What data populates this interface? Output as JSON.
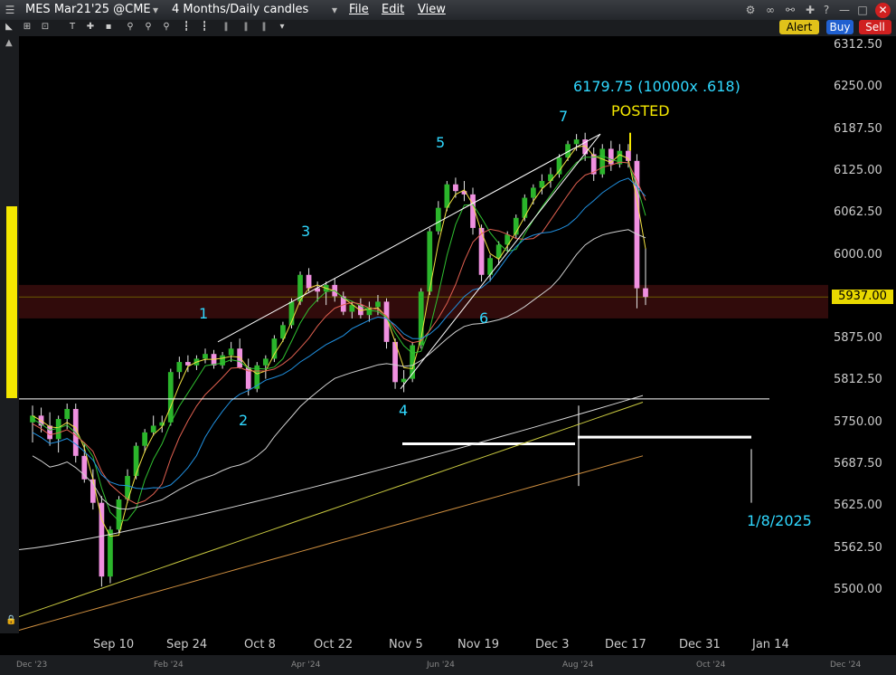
{
  "window": {
    "symbol": "MES Mar21'25 @CME",
    "timeframe": "4 Months/Daily candles",
    "menu": [
      "File",
      "Edit",
      "View"
    ],
    "buttons": {
      "alert": "Alert",
      "buy": "Buy",
      "sell": "Sell"
    }
  },
  "chart_data": {
    "type": "candlestick",
    "y_ticks": [
      "6312.50",
      "6250.00",
      "6187.50",
      "6125.00",
      "6062.50",
      "6000.00",
      "5937.50",
      "5875.00",
      "5812.50",
      "5750.00",
      "5687.50",
      "5625.00",
      "5562.50",
      "5500.00"
    ],
    "ylim": [
      5455,
      6330
    ],
    "x_ticks": [
      "Sep 10",
      "Sep 24",
      "Oct 8",
      "Oct 22",
      "Nov 5",
      "Nov 19",
      "Dec 3",
      "Dec 17",
      "Dec 31",
      "Jan 14"
    ],
    "last_price": "5937.00",
    "scroll_labels": [
      "Dec '23",
      "Feb '24",
      "Apr '24",
      "Jun '24",
      "Aug '24",
      "Oct '24",
      "Dec '24"
    ],
    "annotations": {
      "target": "6179.75 (10000x .618)",
      "posted": "POSTED",
      "date": "1/8/2025",
      "waves": [
        "1",
        "2",
        "3",
        "4",
        "5",
        "6",
        "7"
      ]
    },
    "candles": [
      [
        5750,
        5775,
        5720,
        5760
      ],
      [
        5760,
        5772,
        5735,
        5745
      ],
      [
        5745,
        5765,
        5715,
        5725
      ],
      [
        5725,
        5760,
        5705,
        5755
      ],
      [
        5755,
        5778,
        5740,
        5770
      ],
      [
        5770,
        5778,
        5690,
        5700
      ],
      [
        5700,
        5720,
        5660,
        5665
      ],
      [
        5665,
        5680,
        5620,
        5630
      ],
      [
        5630,
        5640,
        5505,
        5520
      ],
      [
        5520,
        5595,
        5510,
        5590
      ],
      [
        5590,
        5640,
        5585,
        5635
      ],
      [
        5635,
        5680,
        5630,
        5670
      ],
      [
        5670,
        5720,
        5665,
        5715
      ],
      [
        5715,
        5740,
        5705,
        5735
      ],
      [
        5735,
        5760,
        5730,
        5745
      ],
      [
        5745,
        5760,
        5735,
        5750
      ],
      [
        5750,
        5830,
        5745,
        5825
      ],
      [
        5825,
        5848,
        5815,
        5840
      ],
      [
        5840,
        5850,
        5825,
        5835
      ],
      [
        5835,
        5850,
        5828,
        5845
      ],
      [
        5845,
        5860,
        5838,
        5852
      ],
      [
        5852,
        5858,
        5830,
        5835
      ],
      [
        5835,
        5855,
        5830,
        5850
      ],
      [
        5850,
        5870,
        5840,
        5860
      ],
      [
        5860,
        5875,
        5830,
        5832
      ],
      [
        5832,
        5845,
        5790,
        5800
      ],
      [
        5800,
        5840,
        5795,
        5835
      ],
      [
        5835,
        5850,
        5815,
        5845
      ],
      [
        5845,
        5880,
        5840,
        5875
      ],
      [
        5875,
        5900,
        5870,
        5895
      ],
      [
        5895,
        5935,
        5890,
        5930
      ],
      [
        5930,
        5975,
        5925,
        5970
      ],
      [
        5970,
        5980,
        5945,
        5950
      ],
      [
        5950,
        5960,
        5930,
        5945
      ],
      [
        5945,
        5960,
        5925,
        5955
      ],
      [
        5955,
        5965,
        5930,
        5938
      ],
      [
        5938,
        5945,
        5910,
        5915
      ],
      [
        5915,
        5930,
        5905,
        5925
      ],
      [
        5925,
        5935,
        5905,
        5910
      ],
      [
        5910,
        5930,
        5900,
        5922
      ],
      [
        5922,
        5940,
        5910,
        5930
      ],
      [
        5930,
        5935,
        5860,
        5870
      ],
      [
        5870,
        5875,
        5800,
        5810
      ],
      [
        5810,
        5828,
        5795,
        5815
      ],
      [
        5815,
        5870,
        5810,
        5865
      ],
      [
        5865,
        5950,
        5860,
        5945
      ],
      [
        5945,
        6040,
        5940,
        6035
      ],
      [
        6035,
        6080,
        6030,
        6070
      ],
      [
        6070,
        6110,
        6065,
        6105
      ],
      [
        6105,
        6115,
        6085,
        6095
      ],
      [
        6095,
        6110,
        6080,
        6090
      ],
      [
        6090,
        6100,
        6030,
        6040
      ],
      [
        6040,
        6045,
        5960,
        5970
      ],
      [
        5970,
        6000,
        5960,
        5995
      ],
      [
        5995,
        6020,
        5985,
        6015
      ],
      [
        6015,
        6035,
        6005,
        6030
      ],
      [
        6030,
        6060,
        6025,
        6055
      ],
      [
        6055,
        6090,
        6050,
        6085
      ],
      [
        6085,
        6105,
        6075,
        6100
      ],
      [
        6100,
        6120,
        6090,
        6110
      ],
      [
        6110,
        6130,
        6100,
        6120
      ],
      [
        6120,
        6150,
        6115,
        6145
      ],
      [
        6145,
        6170,
        6140,
        6165
      ],
      [
        6165,
        6180,
        6155,
        6172
      ],
      [
        6172,
        6182,
        6140,
        6150
      ],
      [
        6150,
        6160,
        6110,
        6120
      ],
      [
        6120,
        6165,
        6115,
        6158
      ],
      [
        6158,
        6170,
        6125,
        6135
      ],
      [
        6135,
        6165,
        6130,
        6155
      ],
      [
        6155,
        6165,
        6130,
        6140
      ],
      [
        6140,
        6150,
        5920,
        5950
      ],
      [
        5950,
        6010,
        5925,
        5937
      ]
    ]
  }
}
